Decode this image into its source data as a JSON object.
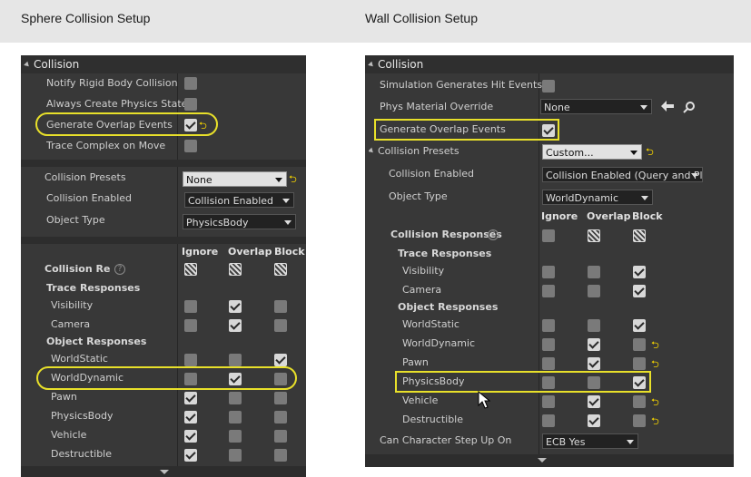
{
  "headings": {
    "left": "Sphere Collision Setup",
    "right": "Wall Collision Setup"
  },
  "columns": {
    "ignore": "Ignore",
    "overlap": "Overlap",
    "block_left": "Block",
    "block_right": "Block"
  },
  "left": {
    "header": "Collision",
    "rows": {
      "notify": "Notify Rigid Body Collision",
      "always_physics": "Always Create Physics State",
      "gen_overlap": "Generate Overlap Events",
      "trace_complex": "Trace Complex on Move",
      "presets": "Collision Presets",
      "enabled": "Collision Enabled",
      "object_type": "Object Type",
      "responses": "Collision Resp",
      "trace_responses": "Trace Responses",
      "visibility": "Visibility",
      "camera": "Camera",
      "object_responses": "Object Responses",
      "worldstatic": "WorldStatic",
      "worlddynamic": "WorldDynamic",
      "pawn": "Pawn",
      "physicsbody": "PhysicsBody",
      "vehicle": "Vehicle",
      "destructible": "Destructible"
    },
    "values": {
      "presets": "None",
      "enabled": "Collision Enabled",
      "object_type": "PhysicsBody"
    }
  },
  "right": {
    "header": "Collision",
    "rows": {
      "sim_hit": "Simulation Generates Hit Events",
      "phys_material": "Phys Material Override",
      "gen_overlap": "Generate Overlap Events",
      "presets": "Collision Presets",
      "enabled": "Collision Enabled",
      "object_type": "Object Type",
      "responses": "Collision Responses",
      "trace_responses": "Trace Responses",
      "visibility": "Visibility",
      "camera": "Camera",
      "object_responses": "Object Responses",
      "worldstatic": "WorldStatic",
      "worlddynamic": "WorldDynamic",
      "pawn": "Pawn",
      "physicsbody": "PhysicsBody",
      "vehicle": "Vehicle",
      "destructible": "Destructible",
      "step_up": "Can Character Step Up On"
    },
    "values": {
      "phys_material": "None",
      "presets": "Custom...",
      "enabled": "Collision Enabled (Query and Pl",
      "object_type": "WorldDynamic",
      "step_up": "ECB Yes"
    }
  },
  "help_glyph": "?",
  "reset_glyph": "⮌",
  "icons": {
    "arrow": "arrow-left-icon",
    "search": "magnifier-icon",
    "cursor": "mouse-cursor-icon"
  },
  "colors": {
    "highlight": "#e8e02a",
    "panel": "#383838",
    "reset_arrow": "#f0d000"
  }
}
